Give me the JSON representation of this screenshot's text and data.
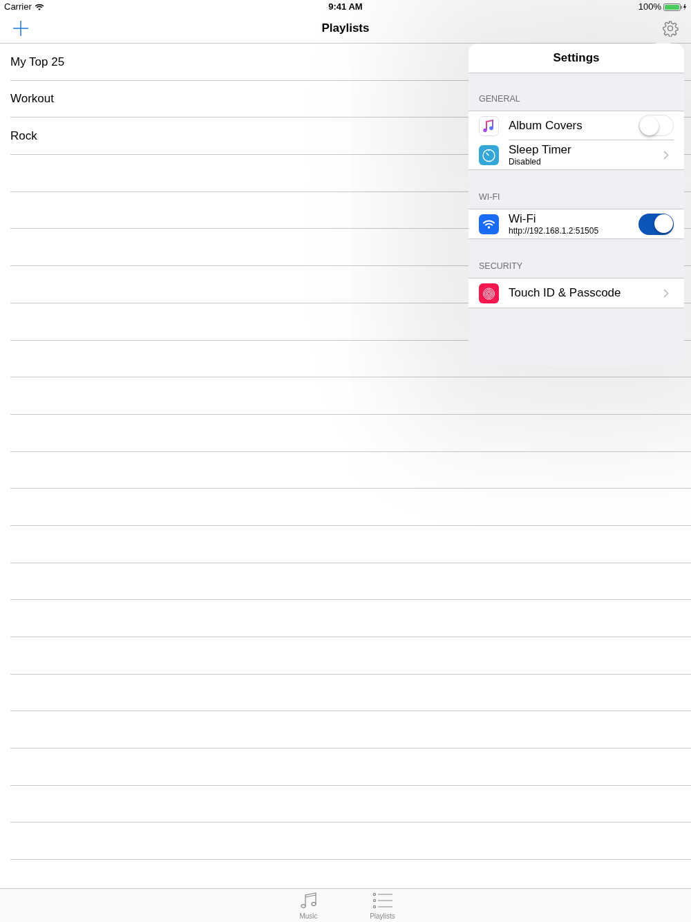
{
  "status_bar": {
    "carrier": "Carrier",
    "time": "9:41 AM",
    "battery": "100%"
  },
  "nav_bar": {
    "title": "Playlists"
  },
  "playlists": [
    "My Top 25",
    "Workout",
    "Rock"
  ],
  "settings": {
    "title": "Settings",
    "sections": [
      {
        "header": "GENERAL",
        "items": [
          {
            "kind": "toggle",
            "label": "Album Covers",
            "on": false
          },
          {
            "kind": "disclosure",
            "label": "Sleep Timer",
            "detail": "Disabled"
          }
        ]
      },
      {
        "header": "WI-FI",
        "items": [
          {
            "kind": "toggle",
            "label": "Wi-Fi",
            "detail": "http://192.168.1.2:51505",
            "on": true
          }
        ]
      },
      {
        "header": "SECURITY",
        "items": [
          {
            "kind": "disclosure",
            "label": "Touch ID & Passcode"
          }
        ]
      }
    ]
  },
  "tab_bar": [
    {
      "label": "Music",
      "selected": false
    },
    {
      "label": "Playlists",
      "selected": false
    }
  ]
}
